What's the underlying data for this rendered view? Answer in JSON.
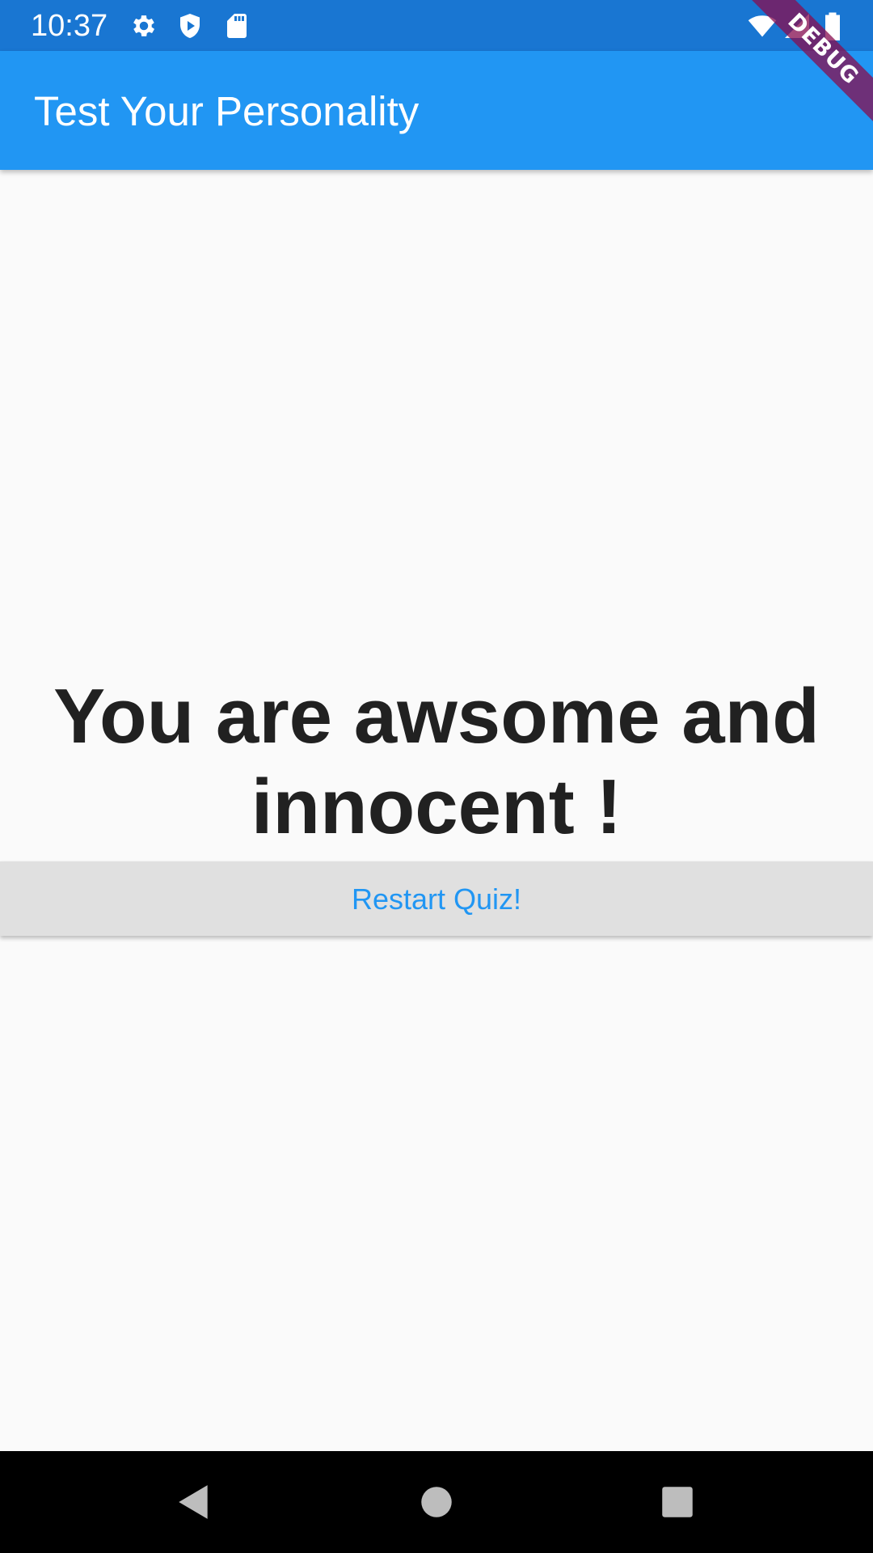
{
  "status_bar": {
    "time": "10:37",
    "icons": [
      "gear-icon",
      "shield-icon",
      "sd-card-icon",
      "wifi-icon",
      "signal-icon",
      "battery-icon"
    ]
  },
  "app_bar": {
    "title": "Test Your Personality"
  },
  "debug_banner": {
    "label": "DEBUG"
  },
  "result": {
    "text": "You are awsome and innocent !"
  },
  "restart_button": {
    "label": "Restart Quiz!"
  },
  "nav_bar": {
    "buttons": [
      "back-icon",
      "home-icon",
      "recents-icon"
    ]
  },
  "colors": {
    "status_bar": "#1976d2",
    "app_bar": "#2196f3",
    "background": "#fafafa",
    "button_bg": "#e0e0e0",
    "button_text": "#2196f3",
    "debug_banner": "#880e4f"
  }
}
